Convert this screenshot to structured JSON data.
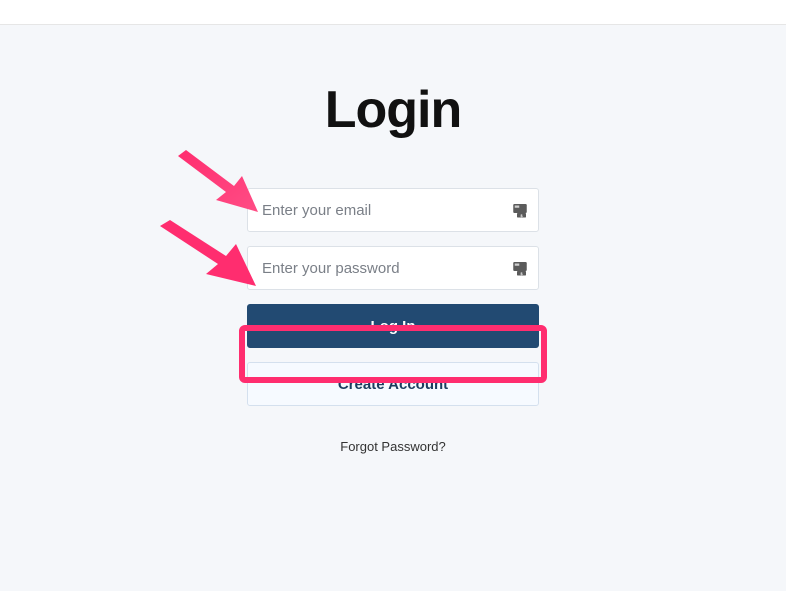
{
  "page": {
    "title": "Login"
  },
  "form": {
    "email_placeholder": "Enter your email",
    "password_placeholder": "Enter your password",
    "login_label": "Log In",
    "create_account_label": "Create Account",
    "forgot_password_label": "Forgot Password?"
  },
  "annotations": {
    "arrow1_target": "email-field",
    "arrow2_target": "password-field",
    "highlight_target": "login-button"
  },
  "colors": {
    "accent_pink": "#ff2d6f",
    "primary_button": "#224a72",
    "page_background": "#f5f7fa"
  }
}
